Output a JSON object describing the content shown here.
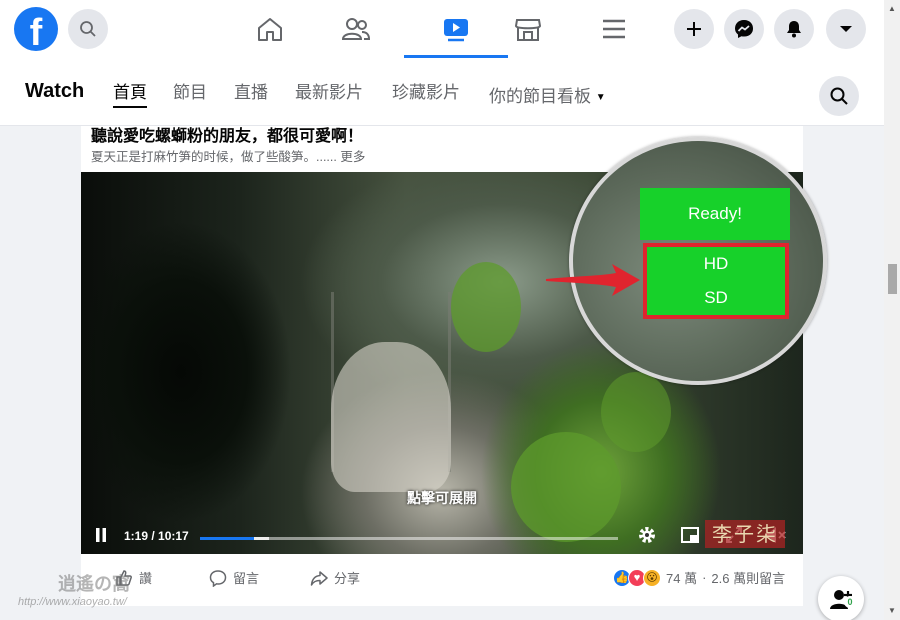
{
  "topnav": {
    "logo": "f",
    "tabs": [
      {
        "name": "home",
        "icon": "home-icon",
        "active": false
      },
      {
        "name": "friends",
        "icon": "friends-icon",
        "active": false
      },
      {
        "name": "watch",
        "icon": "watch-icon",
        "active": true
      },
      {
        "name": "marketplace",
        "icon": "marketplace-icon",
        "active": false
      },
      {
        "name": "menu",
        "icon": "menu-icon",
        "active": false
      }
    ],
    "right_buttons": [
      "plus-icon",
      "messenger-icon",
      "notification-icon",
      "account-caret-icon"
    ],
    "accent_color": "#1877f2"
  },
  "subnav": {
    "title": "Watch",
    "tabs": [
      {
        "label": "首頁",
        "active": true
      },
      {
        "label": "節目",
        "active": false
      },
      {
        "label": "直播",
        "active": false
      },
      {
        "label": "最新影片",
        "active": false
      },
      {
        "label": "珍藏影片",
        "active": false
      }
    ],
    "dropdown_label": "你的節目看板"
  },
  "post": {
    "title": "聽說愛吃螺螄粉的朋友，都很可愛啊！",
    "description": "夏天正是打麻竹笋的时候，做了些酸笋。......",
    "more_label": "更多"
  },
  "video": {
    "overlay_label": "點擊可展開",
    "time_label": "1:19 / 10:17",
    "progress": 0.128,
    "buffered": 0.165,
    "watermark_text": "李子柒"
  },
  "quality_menu": {
    "ready_label": "Ready!",
    "hd_label": "HD",
    "sd_label": "SD",
    "button_color": "#17d12a",
    "highlight_color": "#e0242e"
  },
  "actions": {
    "like_label": "讚",
    "comment_label": "留言",
    "share_label": "分享",
    "reaction_count": "74 萬",
    "separator": "·",
    "comment_count": "2.6 萬則留言"
  },
  "contacts": {
    "badge_count": "0"
  },
  "site_watermark": {
    "name": "逍遙の窩",
    "url": "http://www.xiaoyao.tw/"
  }
}
